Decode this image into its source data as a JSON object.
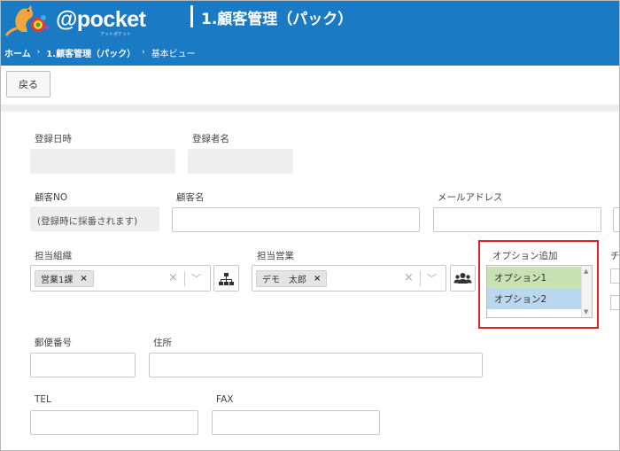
{
  "app": {
    "logo_text": "@pocket",
    "logo_subtext": "アットポケット"
  },
  "header": {
    "title": "1.顧客管理（パック）"
  },
  "breadcrumb": {
    "items": [
      "ホーム",
      "1.顧客管理（パック）",
      "基本ビュー"
    ],
    "separator": "›"
  },
  "toolbar": {
    "back_label": "戻る"
  },
  "form": {
    "registered_at_label": "登録日時",
    "registered_by_label": "登録者名",
    "customer_no_label": "顧客NO",
    "customer_no_value": "(登録時に採番されます)",
    "customer_name_label": "顧客名",
    "email_label": "メールアドレス",
    "org_label": "担当組織",
    "org_tag": "営業1課",
    "sales_label": "担当営業",
    "sales_tag": "デモ　太郎",
    "options_label": "オプション追加",
    "options": [
      "オプション1",
      "オプション2"
    ],
    "truncated_label": "チ",
    "postal_label": "郵便番号",
    "address_label": "住所",
    "tel_label": "TEL",
    "fax_label": "FAX"
  },
  "glyphs": {
    "tag_remove": "×",
    "clear": "×",
    "chevron": "﹀",
    "scroll_up": "▲",
    "scroll_down": "▼"
  },
  "colors": {
    "header_bg": "#1a7ac4",
    "option1_bg": "#c7e1b4",
    "option2_bg": "#b9d7ef",
    "highlight": "#e02020"
  }
}
